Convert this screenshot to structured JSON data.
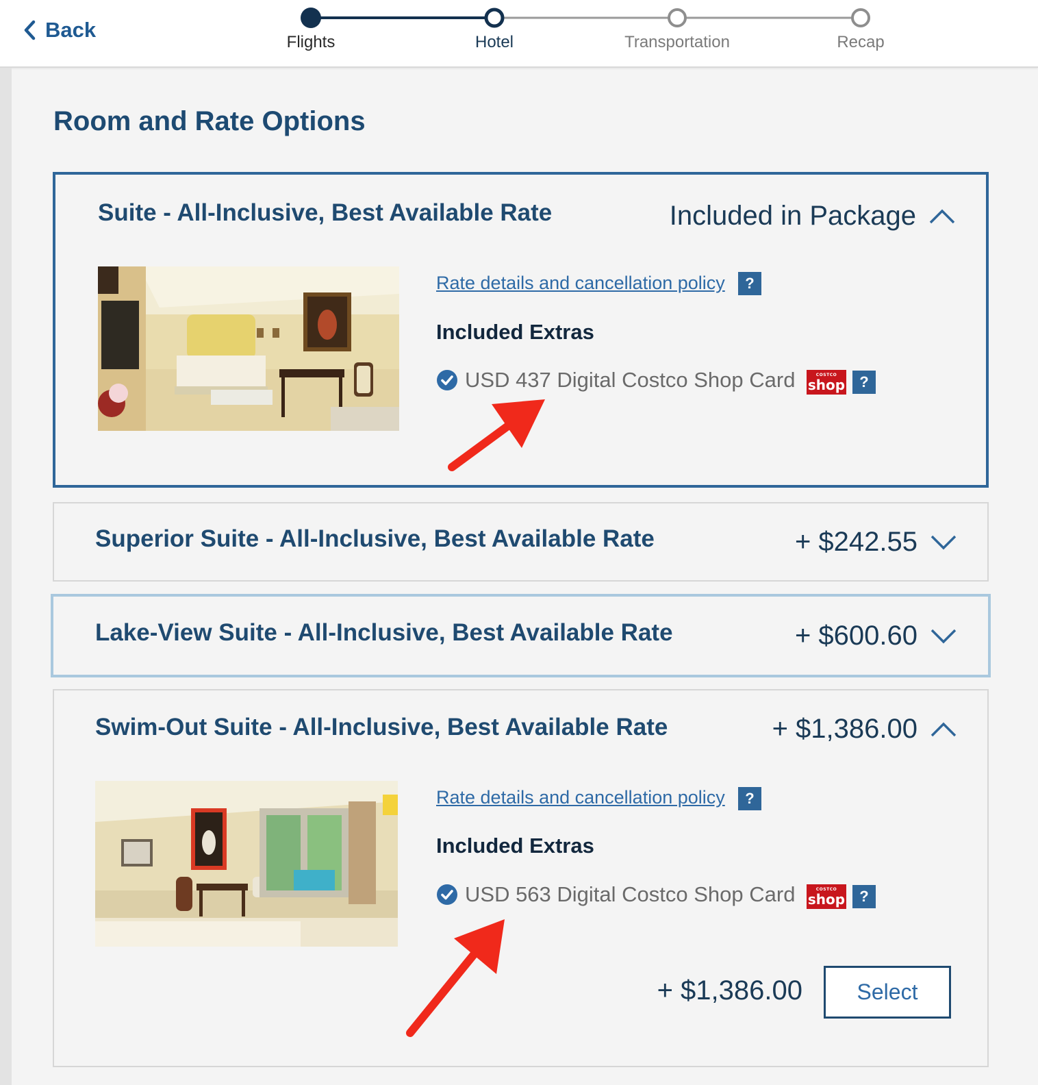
{
  "nav": {
    "back_label": "Back",
    "steps": [
      {
        "label": "Flights",
        "state": "completed"
      },
      {
        "label": "Hotel",
        "state": "current"
      },
      {
        "label": "Transportation",
        "state": "upcoming"
      },
      {
        "label": "Recap",
        "state": "upcoming"
      }
    ]
  },
  "page": {
    "title": "Room and Rate Options"
  },
  "rooms": [
    {
      "title": "Suite - All-Inclusive, Best Available Rate",
      "price_label": "Included in Package",
      "expanded": true,
      "selected": true,
      "rate_link": "Rate details and cancellation policy",
      "help_label": "?",
      "extras_title": "Included Extras",
      "extra_text": "USD 437 Digital Costco Shop Card",
      "extra_logo": "shop"
    },
    {
      "title": "Superior Suite - All-Inclusive, Best Available Rate",
      "price_label": "+ $242.55",
      "expanded": false
    },
    {
      "title": "Lake-View Suite - All-Inclusive, Best Available Rate",
      "price_label": "+ $600.60",
      "expanded": false,
      "hovered": true
    },
    {
      "title": "Swim-Out Suite - All-Inclusive, Best Available Rate",
      "price_label": "+ $1,386.00",
      "expanded": true,
      "rate_link": "Rate details and cancellation policy",
      "help_label": "?",
      "extras_title": "Included Extras",
      "extra_text": "USD 563 Digital Costco Shop Card",
      "extra_logo": "shop",
      "footer_price": "+ $1,386.00",
      "select_label": "Select"
    }
  ],
  "colors": {
    "brand_navy": "#1f4a70",
    "link_blue": "#2e6aa6",
    "selected_border": "#2f6699",
    "hover_border": "#a9c8de",
    "annotation_arrow": "#f0291b",
    "shop_red": "#c8161d"
  }
}
